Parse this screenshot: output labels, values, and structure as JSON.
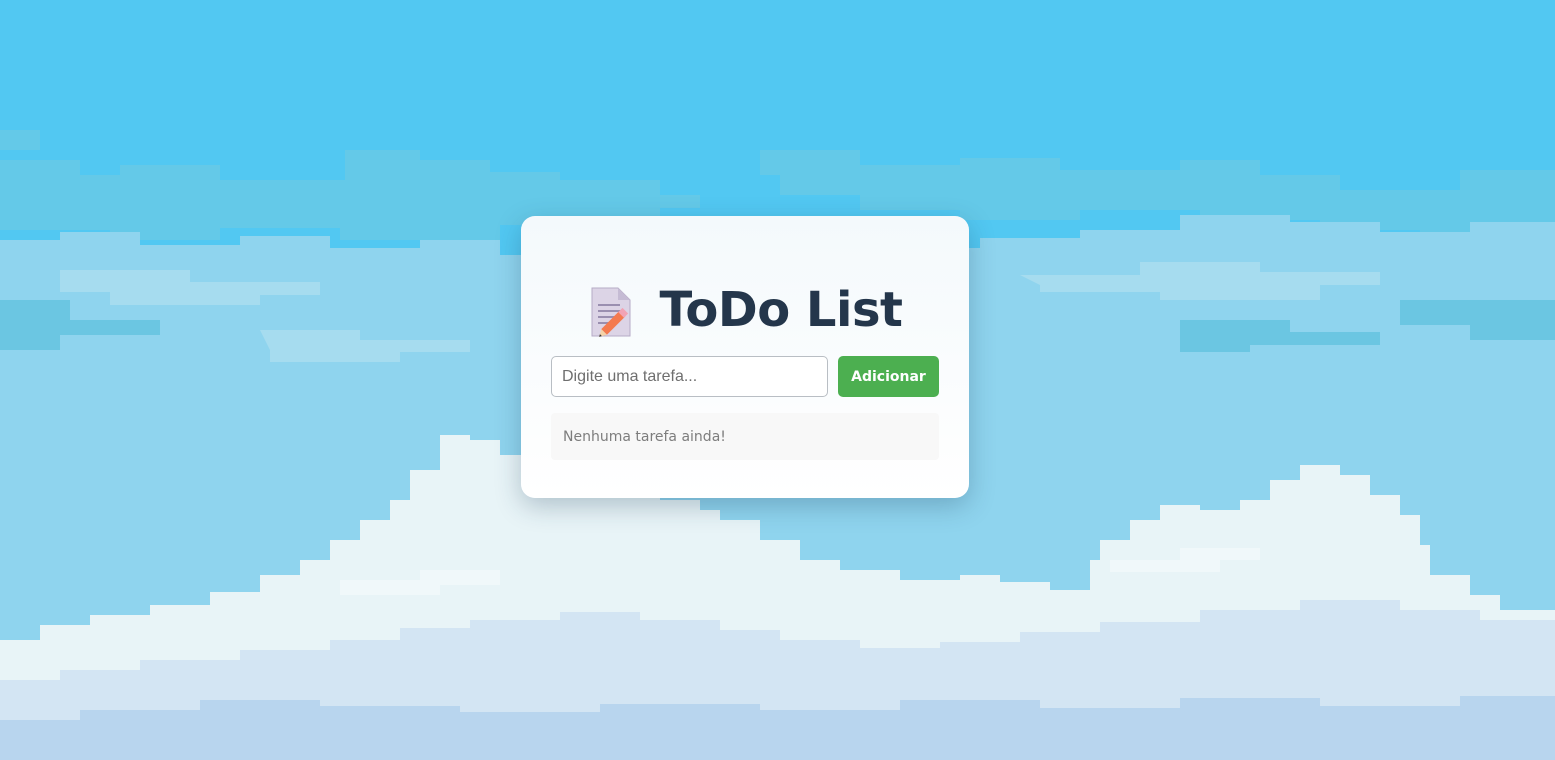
{
  "theme": {
    "sky_color": "#52c8f2",
    "card_bg": "#ffffff",
    "title_color": "#24364b",
    "button_color": "#4caf50",
    "button_text_color": "#ffffff"
  },
  "header": {
    "icon": "memo-pencil-icon",
    "title": "ToDo List"
  },
  "task_form": {
    "input_value": "",
    "input_placeholder": "Digite uma tarefa...",
    "add_label": "Adicionar"
  },
  "task_list": {
    "items": [],
    "empty_message": "Nenhuma tarefa ainda!"
  }
}
